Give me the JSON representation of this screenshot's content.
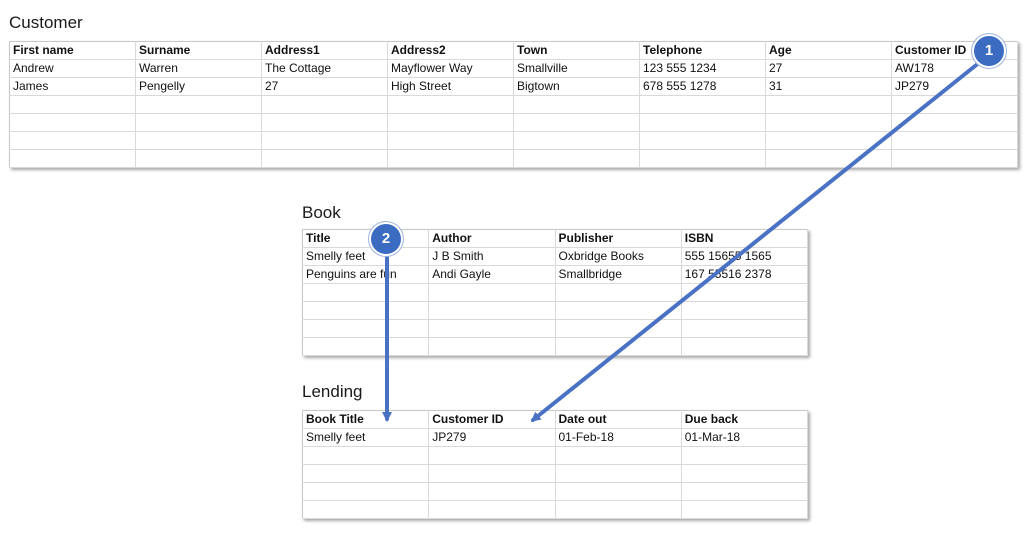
{
  "customer": {
    "title": "Customer",
    "headers": [
      "First name",
      "Surname",
      "Address1",
      "Address2",
      "Town",
      "Telephone",
      "Age",
      "Customer ID"
    ],
    "rows": [
      [
        "Andrew",
        "Warren",
        "The Cottage",
        "Mayflower Way",
        "Smallville",
        "123 555 1234",
        "27",
        "AW178"
      ],
      [
        "James",
        "Pengelly",
        "27",
        "High Street",
        "Bigtown",
        "678 555 1278",
        "31",
        "JP279"
      ]
    ]
  },
  "book": {
    "title": "Book",
    "headers": [
      "Title",
      "Author",
      "Publisher",
      "ISBN"
    ],
    "rows": [
      [
        "Smelly feet",
        "J B Smith",
        "Oxbridge Books",
        "555 15655 1565"
      ],
      [
        "Penguins are fun",
        "Andi Gayle",
        "Smallbridge",
        "167 55516 2378"
      ]
    ]
  },
  "lending": {
    "title": "Lending",
    "headers": [
      "Book Title",
      "Customer ID",
      "Date out",
      "Due back"
    ],
    "rows": [
      [
        "Smelly feet",
        "JP279",
        "01-Feb-18",
        "01-Mar-18"
      ]
    ]
  },
  "badges": {
    "one": "1",
    "two": "2"
  },
  "colors": {
    "arrow": "#4a72c4",
    "badge": "#3b6cc1",
    "gridline": "#d9d9d9"
  }
}
